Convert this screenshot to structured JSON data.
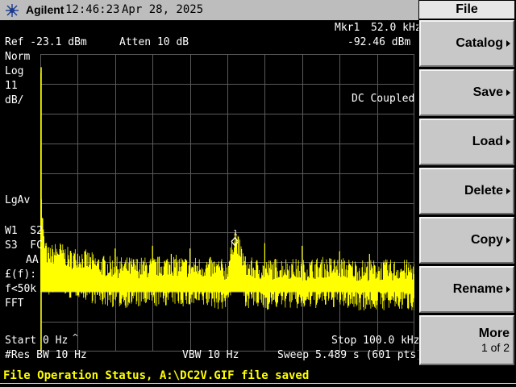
{
  "header": {
    "brand": "Agilent",
    "time": "12:46:23",
    "date": "Apr 28, 2025"
  },
  "screen": {
    "mkr_label": "Mkr1",
    "mkr_freq": "52.0 kHz",
    "mkr_level": "-92.46 dBm",
    "ref": "Ref -23.1 dBm",
    "atten": "Atten 10 dB",
    "scale_mode": "Norm",
    "scale_type": "Log",
    "scale_val": "11",
    "scale_unit": "dB/",
    "coupling": "DC Coupled",
    "avg": "LgAv",
    "w1": "W1  S2",
    "s3": "S3  FC",
    "aa": "AA",
    "ff": "£(f):",
    "fk": "f<50k",
    "fft": "FFT",
    "start": "Start 0 Hz",
    "stop": "Stop 100.0 kHz",
    "res_bw": "#Res BW 10 Hz",
    "vbw": "VBW 10 Hz",
    "sweep": "Sweep 5.489 s (601 pts)",
    "marker_number": "1"
  },
  "softkeys": {
    "title": "File",
    "items": [
      {
        "label": "Catalog",
        "sub": ""
      },
      {
        "label": "Save",
        "sub": ""
      },
      {
        "label": "Load",
        "sub": ""
      },
      {
        "label": "Delete",
        "sub": ""
      },
      {
        "label": "Copy",
        "sub": ""
      },
      {
        "label": "Rename",
        "sub": ""
      },
      {
        "label": "More",
        "sub": "1 of 2"
      }
    ]
  },
  "status": {
    "text": "File Operation Status, A:\\DC2V.GIF file saved"
  },
  "colors": {
    "trace": "#ffff00",
    "grid": "#5a5a5a",
    "text": "#ffffff",
    "softkey_bg": "#c8c8c8",
    "topbar_bg": "#bdbdbd",
    "status_text": "#ffff00"
  },
  "chart_data": {
    "type": "line",
    "title": "",
    "xlabel": "",
    "ylabel": "",
    "x_start_khz": 0,
    "x_stop_khz": 100,
    "ref_level_dbm": -23.1,
    "scale_db_per_div": 11,
    "divisions": 10,
    "noise_floor_dbm": -107,
    "series": [
      {
        "values_x_khz": [
          0,
          0.3,
          1,
          2,
          5,
          8,
          10,
          15,
          20,
          25,
          30,
          35,
          40,
          45,
          50,
          52,
          55,
          60,
          65,
          70,
          75,
          80,
          85,
          90,
          95,
          100
        ],
        "values_dbm": [
          -28,
          -80,
          -95,
          -100,
          -98,
          -101,
          -100,
          -103,
          -104,
          -104,
          -104,
          -103,
          -104,
          -104,
          -105,
          -92.5,
          -104,
          -105,
          -104,
          -105,
          -104,
          -104,
          -105,
          -105,
          -105,
          -105
        ]
      }
    ],
    "spurs_khz": [
      [
        10,
        -97
      ],
      [
        20,
        -95
      ],
      [
        30,
        -94
      ],
      [
        35,
        -97
      ],
      [
        40,
        -95
      ],
      [
        52,
        -92.5
      ],
      [
        60,
        -93
      ],
      [
        70,
        -94
      ],
      [
        80,
        -96
      ],
      [
        88,
        -97
      ]
    ],
    "marker": {
      "x_khz": 52.0,
      "y_dbm": -92.46
    }
  }
}
